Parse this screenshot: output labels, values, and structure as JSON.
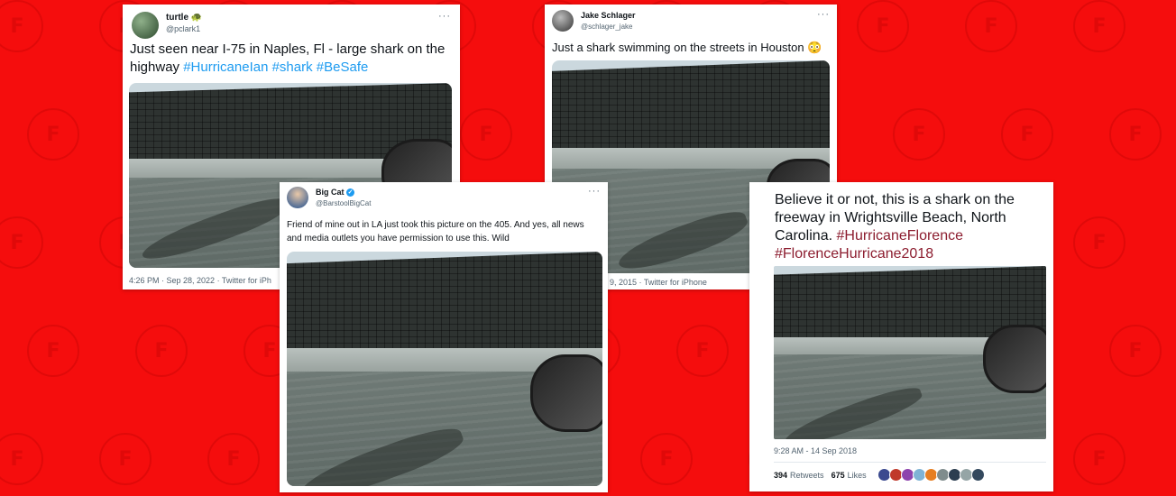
{
  "background": {
    "color": "#f50d0d",
    "watermark_glyph": "F"
  },
  "tweets": [
    {
      "display_name": "turtle 🐢",
      "handle": "@pclark1",
      "text": "Just seen near I-75 in Naples, Fl - large shark on the highway ",
      "hashtags": "#HurricaneIan #shark #BeSafe",
      "timestamp": "4:26 PM · Sep 28, 2022 · Twitter for iPh"
    },
    {
      "display_name": "Jake Schlager",
      "handle": "@schlager_jake",
      "text": "Just a shark swimming on the streets in Houston 😳",
      "timestamp": "9, 2015 · Twitter for iPhone"
    },
    {
      "display_name": "Big Cat",
      "handle": "@BarstoolBigCat",
      "verified": true,
      "text": "Friend of mine out in LA just took this picture on the 405. And yes, all news and media outlets you have permission to use this. Wild"
    },
    {
      "text": "Believe it or not, this is a shark on the freeway in Wrightsville Beach, North Carolina. ",
      "hashtags": "#HurricaneFlorence #FlorenceHurricane2018",
      "timestamp": "9:28 AM - 14 Sep 2018",
      "retweets": "394",
      "retweets_label": "Retweets",
      "likes": "675",
      "likes_label": "Likes"
    }
  ],
  "more_glyph": "···",
  "colors": {
    "link": "#1d9bf0",
    "hashtag_dark": "#8c1d2f",
    "verified": "#1d9bf0"
  }
}
